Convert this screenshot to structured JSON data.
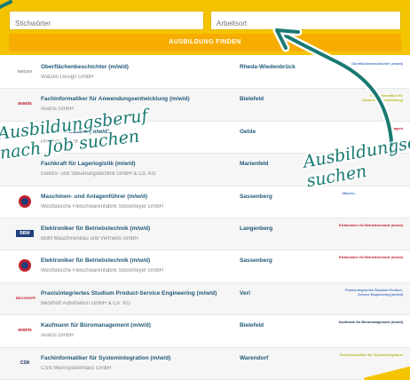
{
  "search": {
    "keyword_placeholder": "Stichwörter",
    "location_placeholder": "Arbeitsort",
    "button_label": "AUSBILDUNG FINDEN"
  },
  "listings": [
    {
      "title": "Oberflächenbeschichter (m/w/d)",
      "company": "Watzen Design GmbH",
      "city": "Rheda-Wiedenbrück",
      "tag": "Oberflächenbeschichter (m/w/d)",
      "logo": "watzen",
      "tag_color": "#4a78c8"
    },
    {
      "title": "Fachinformatiker für Anwendungsentwicklung (m/w/d)",
      "company": "Avanis GmbH",
      "city": "Bielefeld",
      "tag": "Fachinformatiker für Anwendungsentwicklung",
      "logo": "avanis",
      "tag_color": "#c8c820"
    },
    {
      "title": "Fachinformatiker (m/w/d)",
      "company": "Proworks GmbH",
      "city": "Oelde",
      "tag": "Fachagent",
      "logo": "proworks",
      "tag_color": "#c41e2a"
    },
    {
      "title": "Fachkraft für Lagerlogistik (m/w/d)",
      "company": "Elektro- und Steuerungstechnik GmbH & Co. KG",
      "city": "Marienfeld",
      "tag": "",
      "logo": "",
      "tag_color": "#1f5878"
    },
    {
      "title": "Maschinen- und Anlagenführer (m/w/d)",
      "company": "Westfälische Fleischwarenfabrik Stockmeyer GmbH",
      "city": "Sassenberg",
      "tag": "Maschi...",
      "logo": "stockmeyer",
      "tag_color": "#4a78c8"
    },
    {
      "title": "Elektroniker für Betriebstechnik (m/w/d)",
      "company": "BBM Maschinenbau und Vertriebs GmbH",
      "city": "Langenberg",
      "tag": "Elektroniker für Betriebstechnik (m/w/d)",
      "logo": "bbm",
      "tag_color": "#c41e2a"
    },
    {
      "title": "Elektroniker für Betriebstechnik (m/w/d)",
      "company": "Westfälische Fleischwarenfabrik Stockmeyer GmbH",
      "city": "Sassenberg",
      "tag": "Elektroniker für Betriebstechnik (m/w/d)",
      "logo": "stockmeyer",
      "tag_color": "#c41e2a"
    },
    {
      "title": "Praxisintegriertes Studium Product-Service Engineering (m/w/d)",
      "company": "Beckhoff Automation GmbH & Co. KG",
      "city": "Verl",
      "tag": "Praxisintegriertes Studium Product-Service Engineering (m/w/d)",
      "logo": "beckhoff",
      "tag_color": "#4a78c8"
    },
    {
      "title": "Kaufmann für Büromanagement (m/w/d)",
      "company": "Avanis GmbH",
      "city": "Bielefeld",
      "tag": "Kaufmann für Büromanagement (m/w/d)",
      "logo": "avanis",
      "tag_color": "#1e2f5c"
    },
    {
      "title": "Fachinformatiker für Systemintegration (m/w/d)",
      "company": "CSN MeinSystemhaus GmbH",
      "city": "Warendorf",
      "tag": "Fachinformatiker für Systemintegration",
      "logo": "csn",
      "tag_color": "#c8c820"
    }
  ],
  "annotations": {
    "left": "Ausbildungsberuf\nnach Job suchen",
    "right": "Ausbildungsort\nsuchen"
  },
  "colors": {
    "panel": "#f5c400",
    "button": "#f7ad00",
    "teal": "#1a7a72",
    "link": "#1f5878"
  }
}
